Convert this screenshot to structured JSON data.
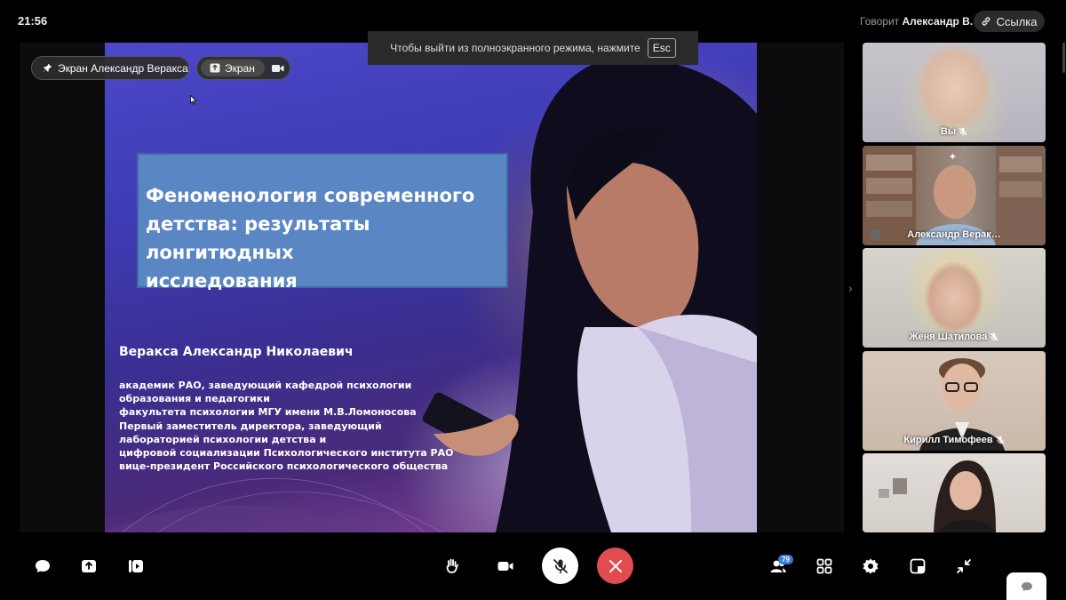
{
  "status": {
    "clock": "21:56"
  },
  "fullscreen_notice": {
    "text": "Чтобы выйти из полноэкранного режима, нажмите",
    "key": "Esc"
  },
  "header": {
    "speaking_prefix": "Говорит",
    "speaking_name": "Александр В.",
    "link_label": "Ссылка"
  },
  "screen_share": {
    "pinned_label": "Экран Александр Веракса",
    "screen_chip_label": "Экран"
  },
  "slide": {
    "title_lines": [
      "Феноменология современного",
      "детства: результаты лонгитюдных",
      "исследования"
    ],
    "author": "Веракса Александр Николаевич",
    "bio_lines": [
      "академик РАО, заведующий кафедрой психологии",
      "образования и педагогики",
      "факультета психологии МГУ имени М.В.Ломоносова",
      "Первый заместитель директора, заведующий",
      "лабораторией психологии детства и",
      "цифровой социализации Психологического института РАО",
      "вице-президент Российского психологического общества"
    ]
  },
  "participants": [
    {
      "name": "Вы",
      "muted": true
    },
    {
      "name": "Александр Верак…",
      "muted": false,
      "pinned": true,
      "sharing": true
    },
    {
      "name": "Женя Шатилова",
      "muted": true
    },
    {
      "name": "Кирилл Тимофеев",
      "muted": true
    },
    {
      "name": "",
      "muted": false
    }
  ],
  "toolbar": {
    "participants_count": "79"
  },
  "colors": {
    "end_call": "#e24b4f",
    "badge": "#3a7bd5",
    "slide_title_bg": "#5a86c4"
  },
  "icons": [
    "chat-icon",
    "share-screen-icon",
    "record-icon",
    "raise-hand-icon",
    "camera-icon",
    "mic-off-icon",
    "end-call-icon",
    "participants-icon",
    "grid-icon",
    "settings-icon",
    "layout-icon",
    "exit-fullscreen-icon"
  ]
}
